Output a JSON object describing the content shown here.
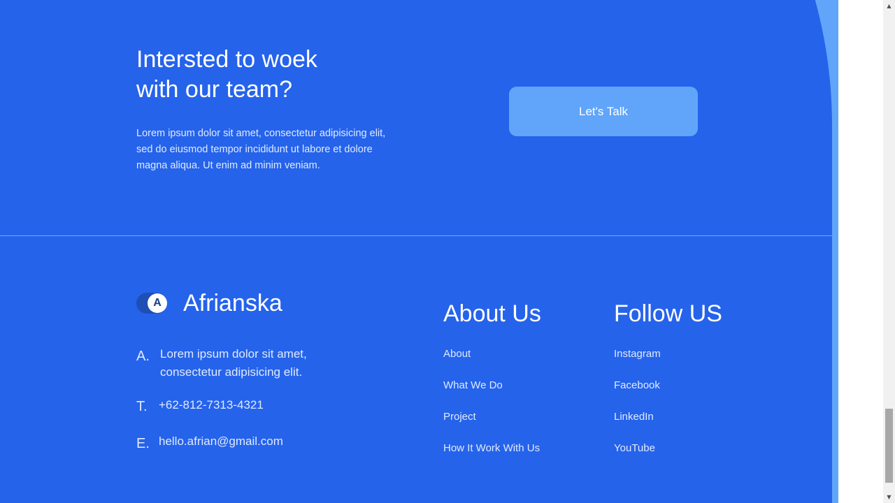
{
  "cta": {
    "title_line1": "Intersted to woek",
    "title_line2": "with our team?",
    "description": "Lorem ipsum dolor sit amet, consectetur adipisicing elit, sed do eiusmod tempor incididunt ut labore et dolore magna aliqua. Ut enim ad minim veniam.",
    "button_label": "Let's Talk"
  },
  "footer": {
    "brand": {
      "logo_letter": "A",
      "name": "Afrianska"
    },
    "contact": {
      "address_prefix": "A.",
      "address_line1": "Lorem ipsum dolor sit amet,",
      "address_line2": "consectetur adipisicing elit.",
      "phone_prefix": "T.",
      "phone": "+62-812-7313-4321",
      "email_prefix": "E.",
      "email": "hello.afrian@gmail.com"
    },
    "about": {
      "title": "About Us",
      "links": [
        "About",
        "What We Do",
        "Project",
        "How It Work With Us"
      ]
    },
    "follow": {
      "title": "Follow US",
      "links": [
        "Instagram",
        "Facebook",
        "LinkedIn",
        "YouTube"
      ]
    }
  },
  "scrollbar": {
    "up_icon": "▲",
    "down_icon": "▼"
  },
  "colors": {
    "primary_blue": "#2563EB",
    "light_blue": "#60A5FA",
    "text_light": "#E0EAFF",
    "white": "#FFFFFF"
  }
}
